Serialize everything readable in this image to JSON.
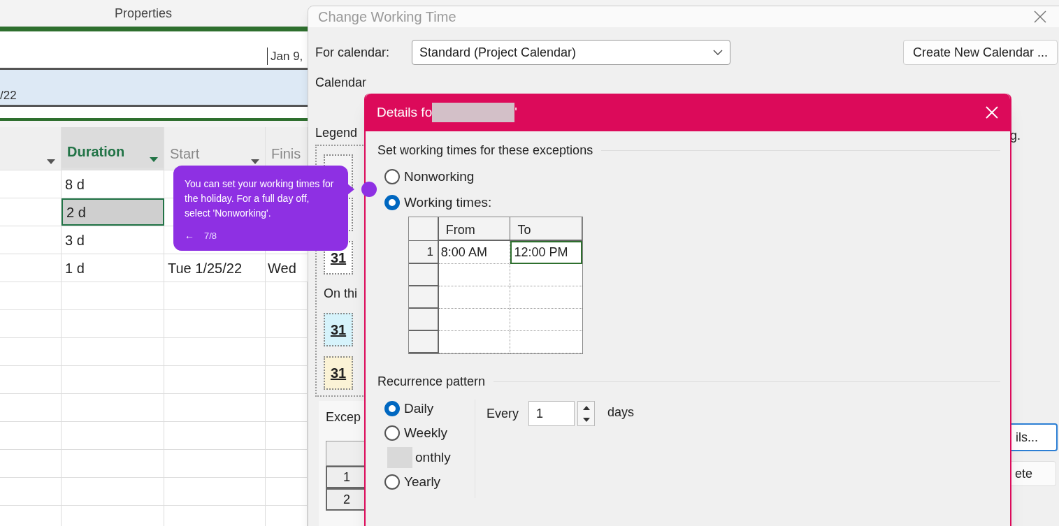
{
  "ribbon": {
    "group_label": "Properties"
  },
  "timeline": {
    "date_label": "Jan 9,",
    "bar_label": "/22"
  },
  "grid": {
    "columns": [
      {
        "kind": "unlabeled",
        "dropdown": true,
        "selected": false
      },
      {
        "kind": "labeled",
        "label": "Duration",
        "dropdown": true,
        "selected": true
      },
      {
        "kind": "labeled",
        "label": "Start",
        "dropdown": true,
        "selected": false
      },
      {
        "kind": "labeled",
        "label": "Finis",
        "dropdown": false,
        "selected": false
      }
    ],
    "rows": [
      {
        "duration": "8 d",
        "selected": false
      },
      {
        "duration": "2 d",
        "selected": true
      },
      {
        "duration": "3 d",
        "selected": false
      },
      {
        "duration": "1 d",
        "start": "Tue 1/25/22",
        "finish": "Wed",
        "selected": false
      }
    ]
  },
  "change_working_time": {
    "title": "Change Working Time",
    "for_calendar_label": "For calendar:",
    "calendar_value": "Standard (Project Calendar)",
    "create_button": "Create New Calendar ...",
    "base_note": "Calendar",
    "legend_label": "Legend",
    "legend_items": [
      {
        "kind": "blank"
      },
      {
        "kind": "blank"
      },
      {
        "kind": "day",
        "label": "31",
        "color": "#ffffff"
      }
    ],
    "on_this_label": "On thi",
    "day_items": [
      {
        "label": "31",
        "color": "#d6f3fb"
      },
      {
        "label": "31",
        "color": "#fbf3d6"
      }
    ],
    "right_note": "g.",
    "details_button": "ils...",
    "delete_button": "ete",
    "exceptions_tab": "Excep",
    "exception_rows": [
      "1",
      "2"
    ]
  },
  "details": {
    "title": "Details fo",
    "title_end": "'",
    "section_label": "Set working times for these exceptions",
    "modes": [
      {
        "label": "Nonworking",
        "selected": false
      },
      {
        "label": "Working times:",
        "selected": true
      }
    ],
    "times": {
      "columns": [
        "From",
        "To"
      ],
      "rows": [
        {
          "number": "1",
          "cells": [
            {
              "text": "8:00 AM",
              "selected": false
            },
            {
              "text": "12:00 PM",
              "selected": true
            }
          ]
        }
      ]
    },
    "recurrence": {
      "label": "Recurrence pattern",
      "options": [
        {
          "kind": "radio",
          "label": "Daily",
          "selected": true
        },
        {
          "kind": "radio",
          "label": "Weekly",
          "selected": false
        },
        {
          "kind": "redacted",
          "label": "onthly",
          "selected": false
        },
        {
          "kind": "radio",
          "label": "Yearly",
          "selected": false
        }
      ],
      "every_label": "Every",
      "every_value": "1",
      "unit": "days"
    }
  },
  "tooltip": {
    "text": "You can set your working times for the holiday. For a full day off, select 'Nonworking'.",
    "back": "←",
    "step": "7/8"
  }
}
